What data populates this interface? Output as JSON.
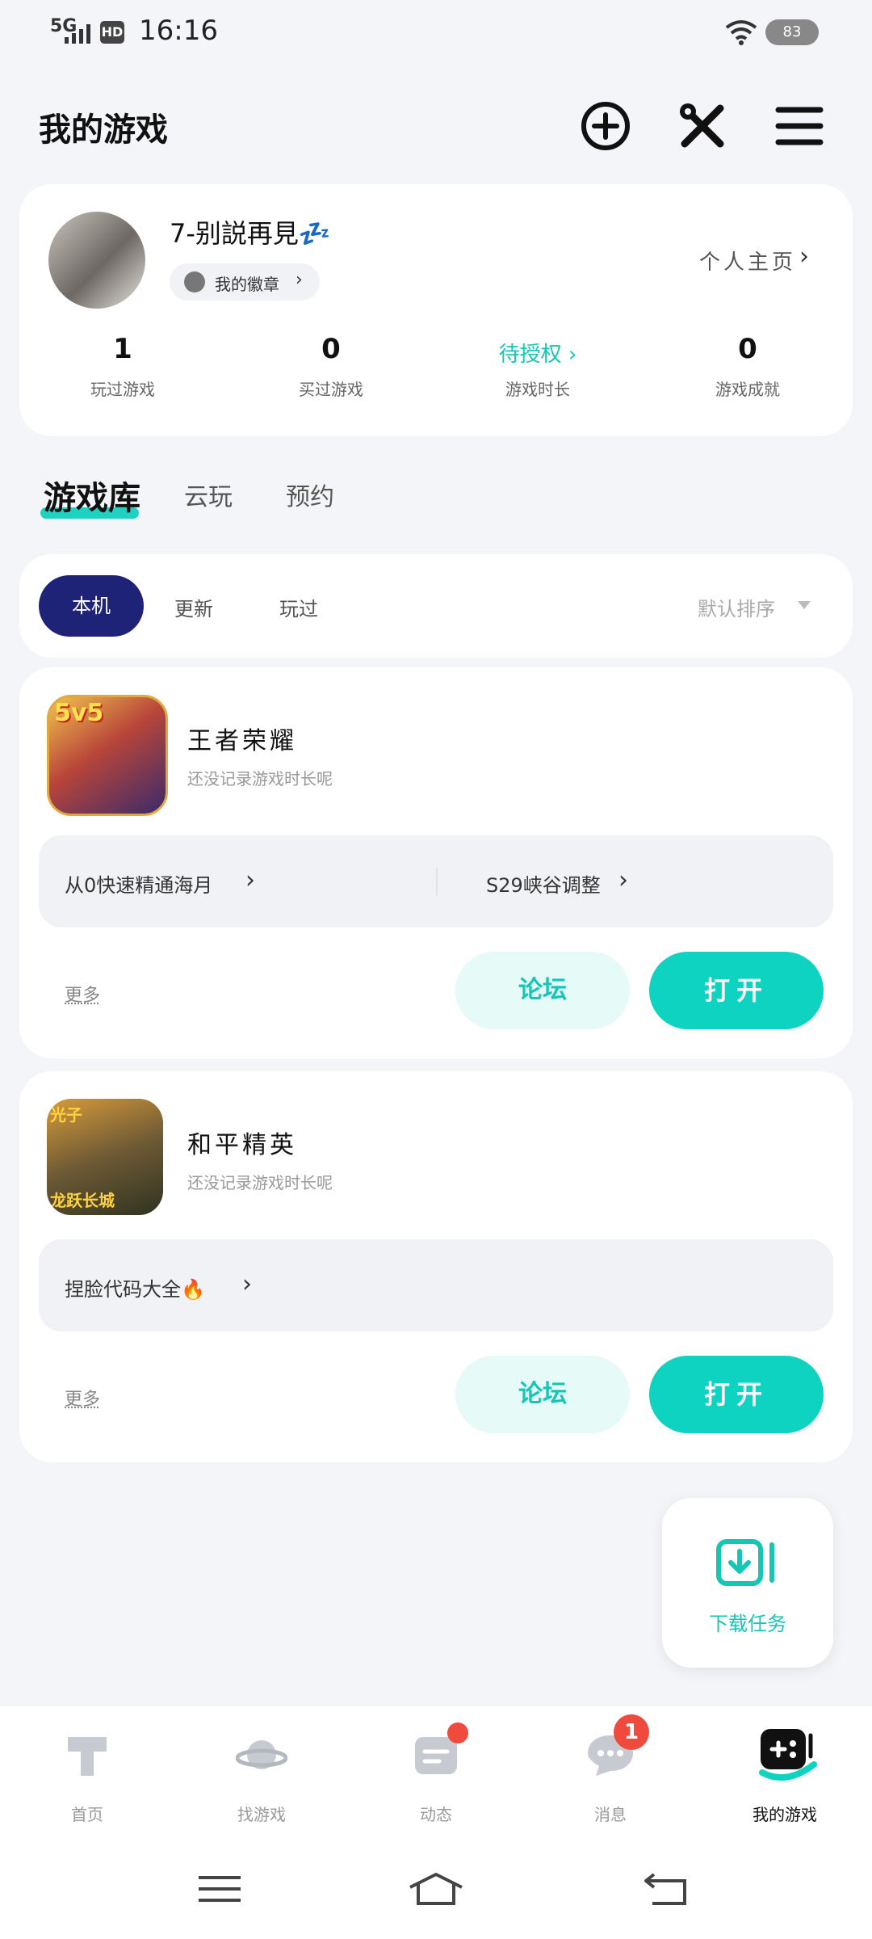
{
  "status_bar": {
    "network": "5G",
    "hd": "HD",
    "time": "16:16",
    "battery": "83"
  },
  "header": {
    "title": "我的游戏"
  },
  "profile": {
    "username": "7-别説再見💤",
    "badge_label": "我的徽章",
    "homepage_label": "个人主页",
    "stats": [
      {
        "value": "1",
        "label": "玩过游戏"
      },
      {
        "value": "0",
        "label": "买过游戏"
      },
      {
        "value": "待授权 ›",
        "label": "游戏时长"
      },
      {
        "value": "0",
        "label": "游戏成就"
      }
    ]
  },
  "tabs": [
    {
      "label": "游戏库"
    },
    {
      "label": "云玩"
    },
    {
      "label": "预约"
    }
  ],
  "filters": {
    "items": [
      {
        "label": "本机"
      },
      {
        "label": "更新"
      },
      {
        "label": "玩过"
      }
    ],
    "sort_label": "默认排序"
  },
  "games": [
    {
      "name": "王者荣耀",
      "subtitle": "还没记录游戏时长呢",
      "tips": [
        "从0快速精通海月",
        "S29峡谷调整"
      ],
      "more_label": "更多",
      "forum_label": "论坛",
      "open_label": "打开"
    },
    {
      "name": "和平精英",
      "subtitle": "还没记录游戏时长呢",
      "tips": [
        "捏脸代码大全🔥"
      ],
      "more_label": "更多",
      "forum_label": "论坛",
      "open_label": "打开"
    }
  ],
  "icon_texts": {
    "hok_badge": "5v5",
    "pubg_line1": "光子",
    "pubg_line2": "龙跃长城"
  },
  "download_task": {
    "label": "下载任务"
  },
  "bottom_nav": [
    {
      "label": "首页",
      "icon": "home-icon"
    },
    {
      "label": "找游戏",
      "icon": "planet-icon"
    },
    {
      "label": "动态",
      "icon": "feed-icon"
    },
    {
      "label": "消息",
      "icon": "message-icon",
      "badge": "1"
    },
    {
      "label": "我的游戏",
      "icon": "gamepad-icon"
    }
  ],
  "colors": {
    "accent": "#0fd3c1",
    "pill": "#1f2378",
    "badge": "#f04a3e"
  }
}
